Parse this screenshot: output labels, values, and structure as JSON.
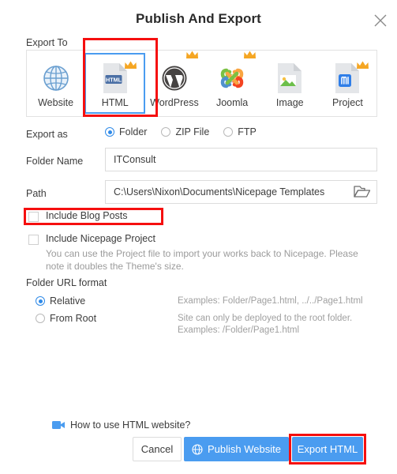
{
  "dialog": {
    "title": "Publish And Export",
    "close_icon": "close-icon"
  },
  "export_to": {
    "label": "Export To",
    "selected": "HTML",
    "items": [
      {
        "label": "Website",
        "icon": "globe-icon",
        "premium": false
      },
      {
        "label": "HTML",
        "icon": "html-file-icon",
        "premium": true
      },
      {
        "label": "WordPress",
        "icon": "wordpress-icon",
        "premium": true
      },
      {
        "label": "Joomla",
        "icon": "joomla-icon",
        "premium": true
      },
      {
        "label": "Image",
        "icon": "image-file-icon",
        "premium": false
      },
      {
        "label": "Project",
        "icon": "project-file-icon",
        "premium": true
      }
    ]
  },
  "export_as": {
    "label": "Export as",
    "selected": "Folder",
    "options": [
      "Folder",
      "ZIP File",
      "FTP"
    ]
  },
  "folder_name": {
    "label": "Folder Name",
    "value": "ITConsult"
  },
  "path": {
    "label": "Path",
    "value": "C:\\Users\\Nixon\\Documents\\Nicepage Templates",
    "browse_icon": "open-folder-icon"
  },
  "checkboxes": [
    {
      "label": "Include Blog Posts",
      "checked": false,
      "hint": ""
    },
    {
      "label": "Include Nicepage Project",
      "checked": false,
      "hint": "You can use the Project file to import your works back to Nicepage. Please note it doubles the Theme's size."
    }
  ],
  "url_format": {
    "label": "Folder URL format",
    "selected": "Relative",
    "options": [
      {
        "label": "Relative",
        "example": "Examples: Folder/Page1.html, ../../Page1.html"
      },
      {
        "label": "From Root",
        "example": "Site can only be deployed to the root folder.\nExamples: /Folder/Page1.html"
      }
    ]
  },
  "footer": {
    "video_icon": "video-camera-icon",
    "video_text": "How to use HTML website?",
    "cancel_label": "Cancel",
    "publish_label": "Publish Website",
    "publish_icon": "globe-icon",
    "export_label": "Export HTML"
  },
  "colors": {
    "accent": "#4a9cf0",
    "annotation": "#f50f0f",
    "crown": "#f5a623",
    "text": "#3c3c3c",
    "muted": "#9b9b9b"
  }
}
